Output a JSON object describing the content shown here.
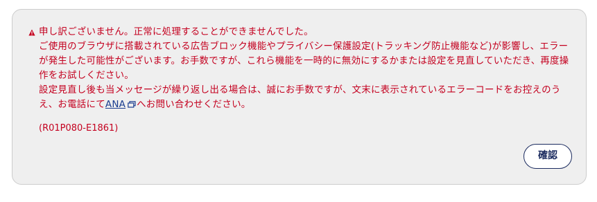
{
  "error": {
    "heading": "申し訳ございません。正常に処理することができませんでした。",
    "body_line1": "ご使用のブラウザに搭載されている広告ブロック機能やプライバシー保護設定(トラッキング防止機能など)が影響し、エラーが発生した可能性がございます。お手数ですが、これら機能を一時的に無効にするかまたは設定を見直していただき、再度操作をお試しください。",
    "body_line2_before": "設定見直し後も当メッセージが繰り返し出る場合は、誠にお手数ですが、文末に表示されているエラーコードをお控えのうえ、お電話にて",
    "link_label": "ANA",
    "body_line2_after": "へお問い合わせください。",
    "error_code": "(R01P080-E1861)"
  },
  "actions": {
    "confirm_label": "確認"
  },
  "colors": {
    "error_text": "#c4001f",
    "link": "#1a3d8f",
    "button_border": "#1a2a5e",
    "panel_bg": "#efefef"
  },
  "icons": {
    "warning": "warning-triangle-icon",
    "external_link": "external-link-icon"
  }
}
